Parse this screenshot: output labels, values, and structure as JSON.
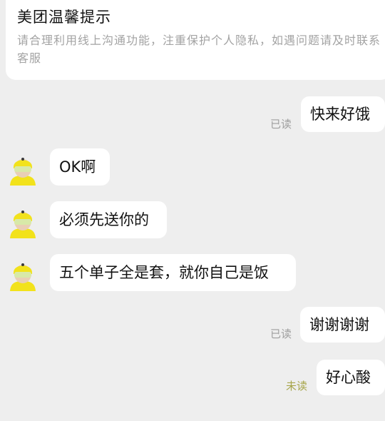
{
  "notice": {
    "title": "美团温馨提示",
    "body": "请合理利用线上沟通功能，注重保护个人隐私，如遇问题请及时联系客服"
  },
  "messages": [
    {
      "side": "right",
      "text": "快来好饿",
      "status": "已读"
    },
    {
      "side": "left",
      "text": "OK啊"
    },
    {
      "side": "left",
      "text": "必须先送你的"
    },
    {
      "side": "left",
      "text": "五个单子全是套，就你自己是饭"
    },
    {
      "side": "right",
      "text": "谢谢谢谢",
      "status": "已读"
    },
    {
      "side": "right",
      "text": "好心酸",
      "status": "未读"
    }
  ],
  "colors": {
    "background": "#eeeeee",
    "bubble": "#ffffff",
    "read_status": "#9e9e9e",
    "unread_status": "#a7a54a",
    "avatar_helmet": "#f2e21b"
  },
  "icons": {
    "avatar": "courier-avatar-icon"
  }
}
